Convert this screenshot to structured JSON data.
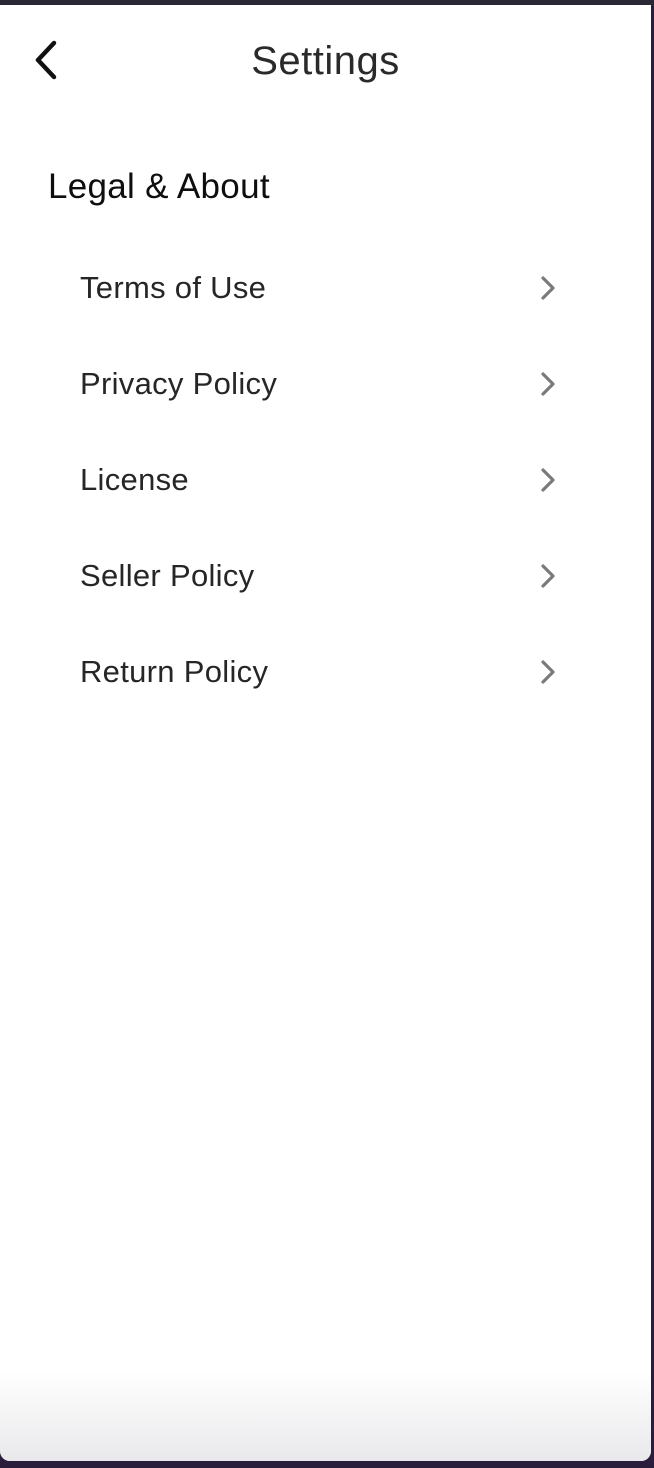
{
  "header": {
    "title": "Settings",
    "back_icon": "chevron-left-icon"
  },
  "section": {
    "heading": "Legal & About"
  },
  "menu": {
    "items": [
      {
        "label": "Terms of Use",
        "icon": "chevron-right-icon"
      },
      {
        "label": "Privacy Policy",
        "icon": "chevron-right-icon"
      },
      {
        "label": "License",
        "icon": "chevron-right-icon"
      },
      {
        "label": "Seller Policy",
        "icon": "chevron-right-icon"
      },
      {
        "label": "Return Policy",
        "icon": "chevron-right-icon"
      }
    ]
  },
  "colors": {
    "background": "#ffffff",
    "text": "#262626",
    "chevron": "#7a7a7a",
    "frame": "#2a1d3c"
  }
}
